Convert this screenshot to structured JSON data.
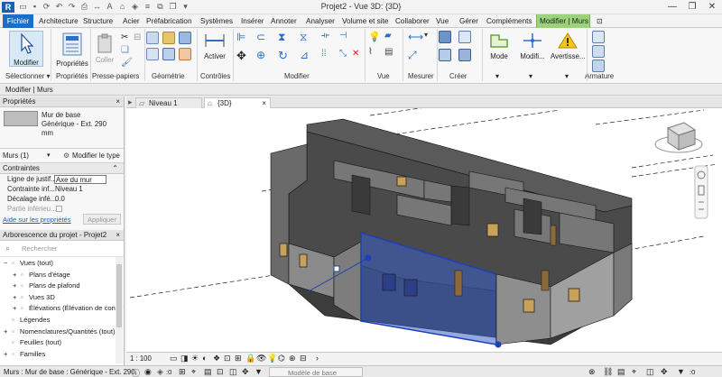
{
  "titlebar": {
    "title": "Projet2 - Vue 3D: {3D}",
    "logo": "R"
  },
  "menubar": {
    "items": [
      "Fichier",
      "Architecture",
      "Structure",
      "Acier",
      "Préfabrication",
      "Systèmes",
      "Insérer",
      "Annoter",
      "Analyser",
      "Volume et site",
      "Collaborer",
      "Vue",
      "Gérer",
      "Compléments",
      "Modifier | Murs"
    ]
  },
  "ribbon": {
    "modifier": "Modifier",
    "proprietes": "Propriétés",
    "coller": "Coller",
    "activer": "Activer",
    "mode": "Mode",
    "modifi": "Modifi...",
    "avertissement": "Avertisse...",
    "panels": {
      "selectionner": "Sélectionner ▾",
      "proprietes": "Propriétés",
      "presse": "Presse-papiers",
      "geometrie": "Géométrie",
      "controles": "Contrôles",
      "modifier": "Modifier",
      "vue": "Vue",
      "mesurer": "Mesurer",
      "creer": "Créer",
      "armature": "Armature"
    },
    "dropdown_arrow": "▾"
  },
  "context_bar": {
    "label": "Modifier | Murs"
  },
  "properties": {
    "header": "Propriétés",
    "close_icon": "×",
    "type_line1": "Mur de base",
    "type_line2": "Générique - Ext. 290",
    "type_line3": "mm",
    "selector_value": "Murs (1)",
    "modify_type": "Modifier le type",
    "section": "Contraintes",
    "rows": [
      {
        "label": "Ligne de justif...",
        "value": "Axe du mur"
      },
      {
        "label": "Contrainte inf...",
        "value": "Niveau 1"
      },
      {
        "label": "Décalage infé...",
        "value": "0.0"
      },
      {
        "label": "Partie inférieu...",
        "value": ""
      }
    ],
    "help_link": "Aide sur les propriétés",
    "apply": "Appliquer"
  },
  "browser": {
    "header": "Arborescence du projet - Projet2",
    "search_placeholder": "Rechercher",
    "items": [
      {
        "label": "Vues (tout)",
        "indent": 0,
        "toggle": "−"
      },
      {
        "label": "Plans d'étage",
        "indent": 1,
        "toggle": "+"
      },
      {
        "label": "Plans de plafond",
        "indent": 1,
        "toggle": "+"
      },
      {
        "label": "Vues 3D",
        "indent": 1,
        "toggle": "+"
      },
      {
        "label": "Élévations (Élévation de constr",
        "indent": 1,
        "toggle": "+"
      },
      {
        "label": "Légendes",
        "indent": 0,
        "toggle": ""
      },
      {
        "label": "Nomenclatures/Quantités (tout)",
        "indent": 0,
        "toggle": "+"
      },
      {
        "label": "Feuilles (tout)",
        "indent": 0,
        "toggle": ""
      },
      {
        "label": "Familles",
        "indent": 0,
        "toggle": "+"
      }
    ]
  },
  "view": {
    "tabs": [
      {
        "label": "Niveau 1",
        "active": false
      },
      {
        "label": "{3D}",
        "active": true
      }
    ],
    "scale": "1 : 100"
  },
  "status": {
    "text": "Murs : Mur de base : Générique - Ext. 290",
    "model": "Modèle de base",
    "filter_count": ":0"
  },
  "colors": {
    "accent": "#1c6fc4",
    "context_tab": "#9bd37a",
    "selection": "#2a4fd6"
  }
}
